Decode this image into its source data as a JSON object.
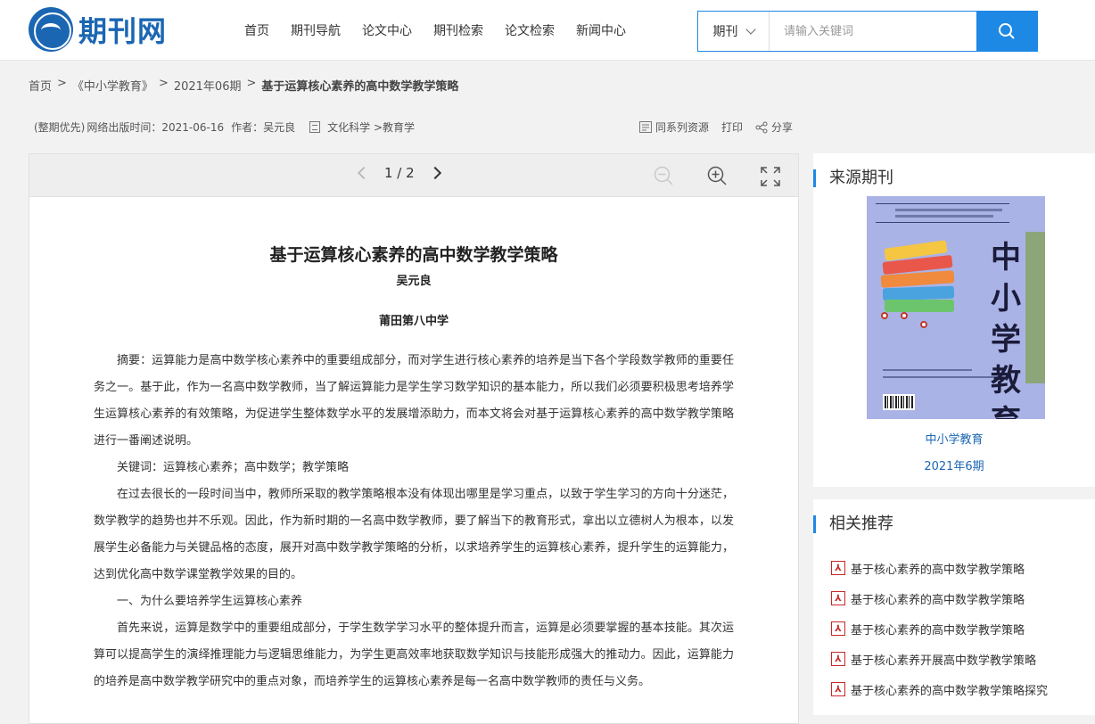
{
  "header": {
    "logo_text": "期刊网",
    "nav": [
      "首页",
      "期刊导航",
      "论文中心",
      "期刊检索",
      "论文检索",
      "新闻中心"
    ],
    "search_type": "期刊",
    "search_placeholder": "请输入关键词"
  },
  "breadcrumb": [
    "首页",
    "《中小学教育》",
    "2021年06期",
    "基于运算核心素养的高中数学教学策略"
  ],
  "meta": {
    "priority": "(整期优先)",
    "publish_time": "网络出版时间：2021-06-16",
    "author": "作者：吴元良",
    "category": "文化科学 >教育学"
  },
  "tools": {
    "series": "同系列资源",
    "print": "打印",
    "share": "分享"
  },
  "reader": {
    "page": "1 / 2"
  },
  "paper": {
    "title": "基于运算核心素养的高中数学教学策略",
    "author": "吴元良",
    "org": "莆田第八中学",
    "paragraphs": [
      "摘要：运算能力是高中数学核心素养中的重要组成部分，而对学生进行核心素养的培养是当下各个学段数学教师的重要任务之一。基于此，作为一名高中数学教师，当了解运算能力是学生学习数学知识的基本能力，所以我们必须要积极思考培养学生运算核心素养的有效策略，为促进学生整体数学水平的发展增添助力，而本文将会对基于运算核心素养的高中数学教学策略进行一番阐述说明。",
      "关键词：运算核心素养；高中数学；教学策略",
      "在过去很长的一段时间当中，教师所采取的教学策略根本没有体现出哪里是学习重点，以致于学生学习的方向十分迷茫，数学教学的趋势也并不乐观。因此，作为新时期的一名高中数学教师，要了解当下的教育形式，拿出以立德树人为根本，以发展学生必备能力与关键品格的态度，展开对高中数学教学策略的分析，以求培养学生的运算核心素养，提升学生的运算能力，达到优化高中数学课堂教学效果的目的。",
      "一、为什么要培养学生运算核心素养",
      "首先来说，运算是数学中的重要组成部分，于学生数学学习水平的整体提升而言，运算是必须要掌握的基本技能。其次运算可以提高学生的演绎推理能力与逻辑思维能力，为学生更高效率地获取数学知识与技能形成强大的推动力。因此，运算能力的培养是高中数学教学研究中的重点对象，而培养学生的运算核心素养是每一名高中数学教师的责任与义务。"
    ]
  },
  "sidebar": {
    "source_title": "来源期刊",
    "cover_title": "中小学教育",
    "journal_name": "中小学教育",
    "journal_issue": "2021年6期",
    "rec_title": "相关推荐",
    "recommendations": [
      "基于核心素养的高中数学教学策略",
      "基于核心素养的高中数学教学策略",
      "基于核心素养的高中数学教学策略",
      "基于核心素养开展高中数学教学策略",
      "基于核心素养的高中数学教学策略探究"
    ]
  },
  "colors": {
    "accent": "#1e88e5",
    "brand": "#1b66b3",
    "pdf": "#c62828",
    "cover": "#a9b3e6"
  }
}
